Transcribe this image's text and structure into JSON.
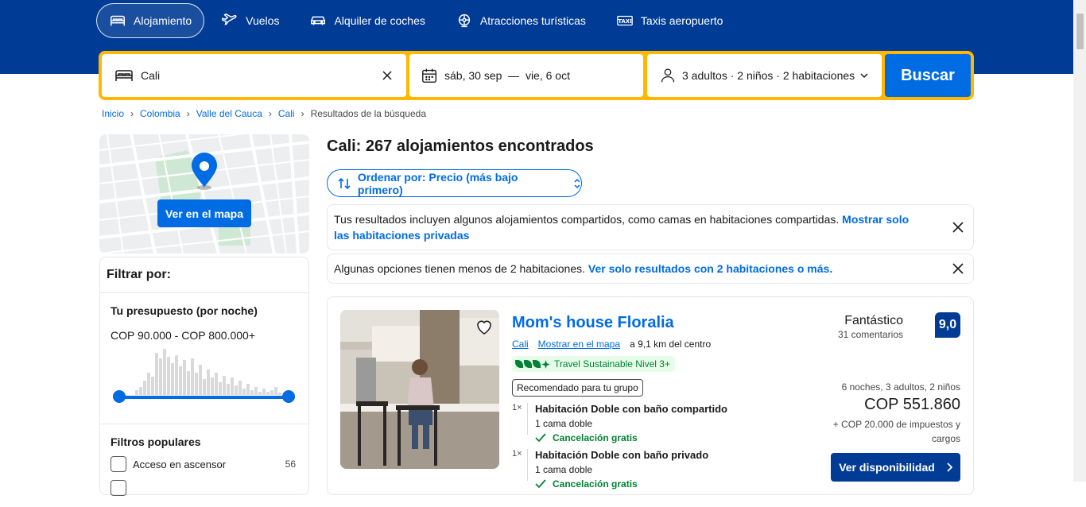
{
  "nav": {
    "items": [
      {
        "label": "Alojamiento",
        "icon": "bed-icon",
        "active": true
      },
      {
        "label": "Vuelos",
        "icon": "plane-icon"
      },
      {
        "label": "Alquiler de coches",
        "icon": "car-icon"
      },
      {
        "label": "Atracciones turísticas",
        "icon": "attractions-icon"
      },
      {
        "label": "Taxis aeropuerto",
        "icon": "taxi-icon"
      }
    ]
  },
  "search": {
    "destination": "Cali",
    "dates": "sáb, 30 sep  —  vie, 6 oct",
    "occupancy": "3 adultos · 2 niños · 2 habitaciones",
    "button": "Buscar"
  },
  "breadcrumb": [
    "Inicio",
    "Colombia",
    "Valle del Cauca",
    "Cali",
    "Resultados de la búsqueda"
  ],
  "map": {
    "button": "Ver en el mapa"
  },
  "filters": {
    "title": "Filtrar por:",
    "budget_title": "Tu presupuesto (por noche)",
    "budget_range": "COP 90.000 - COP 800.000+",
    "popular_title": "Filtros populares",
    "popular_items": [
      {
        "label": "Acceso en ascensor",
        "count": "56"
      }
    ]
  },
  "results": {
    "title": "Cali: 267 alojamientos encontrados",
    "sort_label": "Ordenar por: Precio (más bajo primero)",
    "notice1_text": "Tus resultados incluyen algunos alojamientos compartidos, como camas en habitaciones compartidas. ",
    "notice1_link": "Mostrar solo las habitaciones privadas",
    "notice2_text": "Algunas opciones tienen menos de 2 habitaciones. ",
    "notice2_link": "Ver solo resultados con 2 habitaciones o más."
  },
  "property": {
    "name": "Mom's house Floralia",
    "city_link": "Cali",
    "map_link": "Mostrar en el mapa",
    "distance": "a 9,1 km del centro",
    "sustainable": "Travel Sustainable Nivel 3+",
    "recommended": "Recomendado para tu grupo",
    "rooms": [
      {
        "mult": "1×",
        "name": "Habitación Doble con baño compartido",
        "bed": "1 cama doble",
        "cancel": "Cancelación gratis"
      },
      {
        "mult": "1×",
        "name": "Habitación Doble con baño privado",
        "bed": "1 cama doble",
        "cancel": "Cancelación gratis"
      }
    ],
    "rating_word": "Fantástico",
    "reviews": "31 comentarios",
    "score": "9,0",
    "stay": "6 noches, 3 adultos, 2 niños",
    "price": "COP 551.860",
    "taxes": "+ COP 20.000 de impuestos y cargos",
    "button": "Ver disponibilidad"
  },
  "colors": {
    "brand": "#003b95",
    "accent": "#006ce4",
    "search_border": "#ffb700",
    "green": "#008234"
  }
}
